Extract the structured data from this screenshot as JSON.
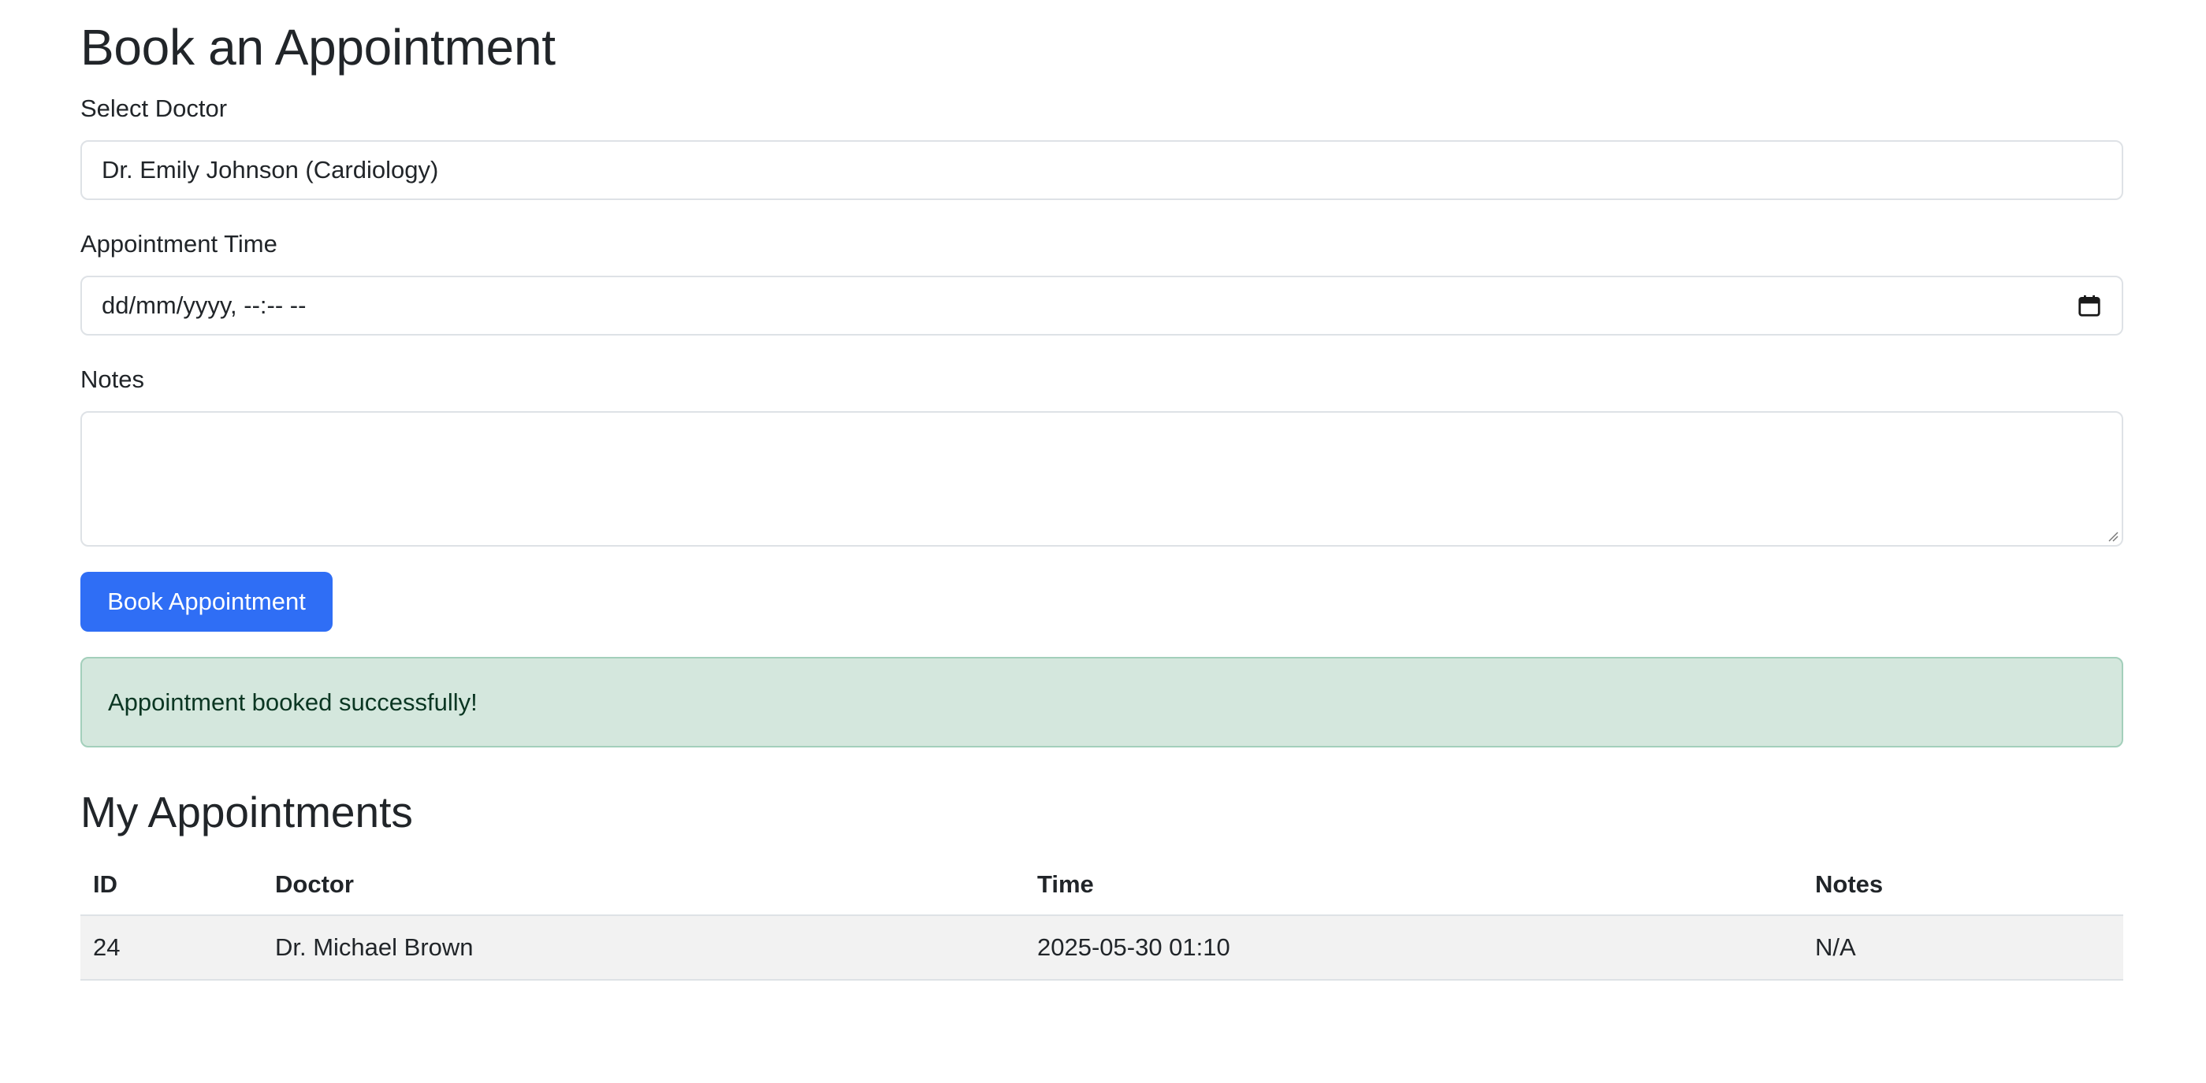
{
  "page": {
    "title": "Book an Appointment"
  },
  "form": {
    "doctor_label": "Select Doctor",
    "doctor_selected": "Dr. Emily Johnson (Cardiology)",
    "time_label": "Appointment Time",
    "time_placeholder": "dd/mm/yyyy, --:-- --",
    "time_icon": "calendar-icon",
    "notes_label": "Notes",
    "notes_value": "",
    "submit_label": "Book Appointment"
  },
  "alert": {
    "message": "Appointment booked successfully!",
    "background_color": "#d4e7dd",
    "border_color": "#a3cfbb"
  },
  "appointments": {
    "title": "My Appointments",
    "columns": [
      "ID",
      "Doctor",
      "Time",
      "Notes"
    ],
    "rows": [
      {
        "id": "24",
        "doctor": "Dr. Michael Brown",
        "time": "2025-05-30 01:10",
        "notes": "N/A"
      }
    ]
  },
  "colors": {
    "primary": "#2f6ef5",
    "text": "#212529",
    "border": "#dee2e6",
    "row_stripe": "#f2f2f2"
  }
}
